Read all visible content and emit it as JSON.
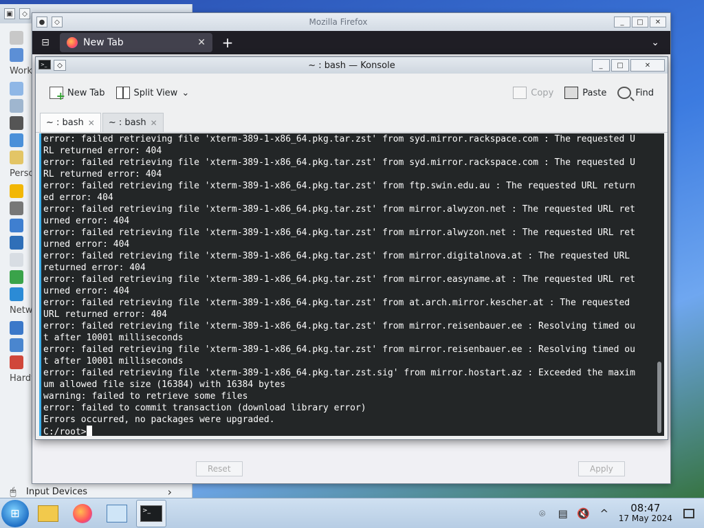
{
  "background_settings": {
    "sections": [
      "Work",
      "Perso",
      "Netw",
      "Hardw"
    ],
    "bottom_item": "Input Devices"
  },
  "firefox": {
    "title": "Mozilla Firefox",
    "tab_label": "New Tab",
    "reset_label": "Reset",
    "apply_label": "Apply"
  },
  "konsole": {
    "title": "~ : bash — Konsole",
    "toolbar": {
      "new_tab": "New Tab",
      "split_view": "Split View",
      "copy": "Copy",
      "paste": "Paste",
      "find": "Find"
    },
    "tabs": [
      {
        "label": "~ : bash"
      },
      {
        "label": "~ : bash"
      }
    ],
    "terminal_lines": [
      "error: failed retrieving file 'xterm-389-1-x86_64.pkg.tar.zst' from syd.mirror.rackspace.com : The requested U",
      "RL returned error: 404",
      "error: failed retrieving file 'xterm-389-1-x86_64.pkg.tar.zst' from syd.mirror.rackspace.com : The requested U",
      "RL returned error: 404",
      "error: failed retrieving file 'xterm-389-1-x86_64.pkg.tar.zst' from ftp.swin.edu.au : The requested URL return",
      "ed error: 404",
      "error: failed retrieving file 'xterm-389-1-x86_64.pkg.tar.zst' from mirror.alwyzon.net : The requested URL ret",
      "urned error: 404",
      "error: failed retrieving file 'xterm-389-1-x86_64.pkg.tar.zst' from mirror.alwyzon.net : The requested URL ret",
      "urned error: 404",
      "error: failed retrieving file 'xterm-389-1-x86_64.pkg.tar.zst' from mirror.digitalnova.at : The requested URL",
      "returned error: 404",
      "error: failed retrieving file 'xterm-389-1-x86_64.pkg.tar.zst' from mirror.easyname.at : The requested URL ret",
      "urned error: 404",
      "error: failed retrieving file 'xterm-389-1-x86_64.pkg.tar.zst' from at.arch.mirror.kescher.at : The requested",
      "URL returned error: 404",
      "error: failed retrieving file 'xterm-389-1-x86_64.pkg.tar.zst' from mirror.reisenbauer.ee : Resolving timed ou",
      "t after 10001 milliseconds",
      "error: failed retrieving file 'xterm-389-1-x86_64.pkg.tar.zst' from mirror.reisenbauer.ee : Resolving timed ou",
      "t after 10001 milliseconds",
      "error: failed retrieving file 'xterm-389-1-x86_64.pkg.tar.zst.sig' from mirror.hostart.az : Exceeded the maxim",
      "um allowed file size (16384) with 16384 bytes",
      "warning: failed to retrieve some files",
      "error: failed to commit transaction (download library error)",
      "Errors occurred, no packages were upgraded."
    ],
    "prompt": "C:/root>"
  },
  "taskbar": {
    "time": "08:47",
    "date": "17 May 2024"
  },
  "colors": {
    "terminal_bg": "#232627",
    "terminal_fg": "#fcfcfc",
    "accent": "#3daee9"
  }
}
